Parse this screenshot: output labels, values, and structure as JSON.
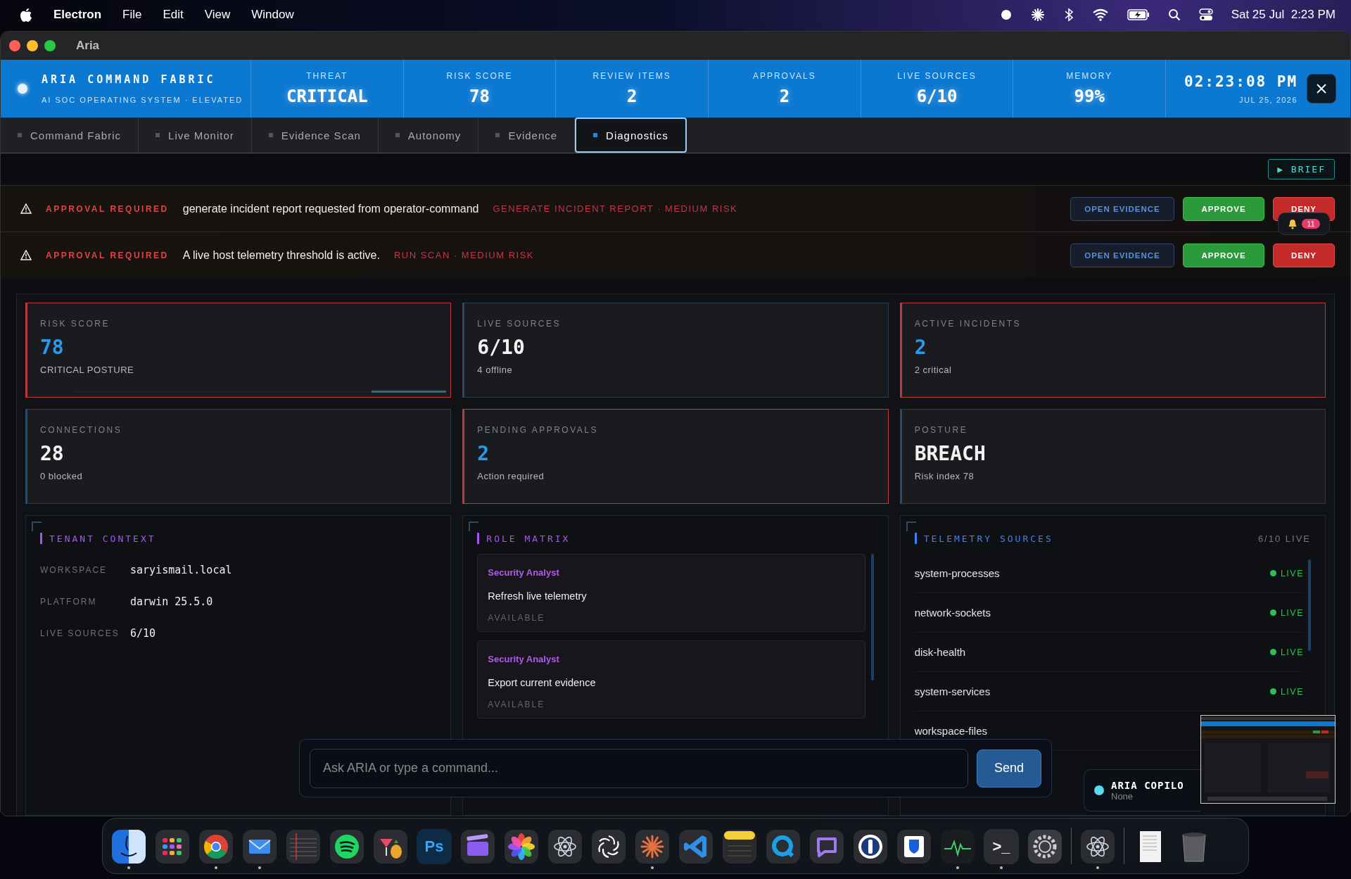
{
  "menu_bar": {
    "app": "Electron",
    "menus": [
      "File",
      "Edit",
      "View",
      "Window"
    ],
    "clock": "Sat 25 Jul  2:23 PM"
  },
  "window": {
    "title": "Aria"
  },
  "header": {
    "brand": "ARIA COMMAND FABRIC",
    "subtitle": "AI SOC OPERATING SYSTEM · ELEVATED",
    "metrics": [
      {
        "label": "THREAT",
        "value": "CRITICAL"
      },
      {
        "label": "RISK SCORE",
        "value": "78"
      },
      {
        "label": "REVIEW ITEMS",
        "value": "2"
      },
      {
        "label": "APPROVALS",
        "value": "2"
      },
      {
        "label": "LIVE SOURCES",
        "value": "6/10"
      },
      {
        "label": "MEMORY",
        "value": "99%"
      }
    ],
    "time": "02:23:08 PM",
    "date": "JUL 25, 2026"
  },
  "tabs": [
    {
      "label": "Command Fabric",
      "selected": false
    },
    {
      "label": "Live Monitor",
      "selected": false
    },
    {
      "label": "Evidence Scan",
      "selected": false
    },
    {
      "label": "Autonomy",
      "selected": false
    },
    {
      "label": "Evidence",
      "selected": false
    },
    {
      "label": "Diagnostics",
      "selected": true
    }
  ],
  "brief_button": "▶ BRIEF",
  "approvals": [
    {
      "label": "APPROVAL REQUIRED",
      "message": "generate incident report requested from operator-command",
      "tag": "GENERATE INCIDENT REPORT · MEDIUM RISK",
      "buttons": [
        "OPEN EVIDENCE",
        "APPROVE",
        "DENY"
      ]
    },
    {
      "label": "APPROVAL REQUIRED",
      "message": "A live host telemetry threshold is active.",
      "tag": "RUN SCAN · MEDIUM RISK",
      "buttons": [
        "OPEN EVIDENCE",
        "APPROVE",
        "DENY"
      ]
    }
  ],
  "notifications": {
    "count": "11"
  },
  "stat_cards": [
    {
      "label": "RISK SCORE",
      "value": "78",
      "sub": "CRITICAL POSTURE",
      "alert": true,
      "accent": true,
      "level": 0.2
    },
    {
      "label": "LIVE SOURCES",
      "value": "6/10",
      "sub": "4 offline",
      "alert": false,
      "accent": false
    },
    {
      "label": "ACTIVE INCIDENTS",
      "value": "2",
      "sub": "2 critical",
      "alert": true,
      "accent": true
    },
    {
      "label": "CONNECTIONS",
      "value": "28",
      "sub": "0 blocked",
      "alert": false,
      "accent": false
    },
    {
      "label": "PENDING APPROVALS",
      "value": "2",
      "sub": "Action required",
      "alert": true,
      "accent": true
    },
    {
      "label": "POSTURE",
      "value": "BREACH",
      "sub": "Risk index 78",
      "alert": false,
      "accent": false
    }
  ],
  "tenant_context": {
    "title": "TENANT CONTEXT",
    "color": "#a855f7",
    "rows": [
      {
        "key": "WORKSPACE",
        "value": "saryismail.local"
      },
      {
        "key": "PLATFORM",
        "value": "darwin 25.5.0"
      },
      {
        "key": "LIVE SOURCES",
        "value": "6/10"
      }
    ]
  },
  "role_matrix": {
    "title": "ROLE MATRIX",
    "color": "#a855f7",
    "items": [
      {
        "role": "Security Analyst",
        "action": "Refresh live telemetry",
        "status": "AVAILABLE"
      },
      {
        "role": "Security Analyst",
        "action": "Export current evidence",
        "status": "AVAILABLE"
      }
    ]
  },
  "telemetry_sources": {
    "title": "TELEMETRY SOURCES",
    "color": "#3b82f6",
    "summary": "6/10 LIVE",
    "items": [
      {
        "name": "system-processes",
        "status": "LIVE",
        "live": true
      },
      {
        "name": "network-sockets",
        "status": "LIVE",
        "live": true
      },
      {
        "name": "disk-health",
        "status": "LIVE",
        "live": true
      },
      {
        "name": "system-services",
        "status": "LIVE",
        "live": true
      },
      {
        "name": "workspace-files"
      }
    ]
  },
  "command_bar": {
    "placeholder": "Ask ARIA or type a command...",
    "button": "Send"
  },
  "copilot": {
    "title": "ARIA COPILO",
    "status": "None"
  },
  "dock": [
    {
      "kind": "face",
      "running": true
    },
    {
      "kind": "grid",
      "running": false
    },
    {
      "kind": "globe",
      "running": true
    },
    {
      "kind": "envelope",
      "running": true
    },
    {
      "kind": "ruled",
      "running": false
    },
    {
      "kind": "waves",
      "running": false
    },
    {
      "kind": "drink",
      "running": false
    },
    {
      "kind": "letters",
      "label": "Ps",
      "running": false
    },
    {
      "kind": "clapper",
      "running": false
    },
    {
      "kind": "flower",
      "running": false
    },
    {
      "kind": "atom",
      "running": false
    },
    {
      "kind": "knot",
      "running": false
    },
    {
      "kind": "asterisk",
      "running": true
    },
    {
      "kind": "code",
      "running": false
    },
    {
      "kind": "notepad",
      "running": false
    },
    {
      "kind": "magnifier",
      "running": false
    },
    {
      "kind": "bubble",
      "running": false
    },
    {
      "kind": "keyhole",
      "running": false
    },
    {
      "kind": "shield",
      "running": false
    },
    {
      "kind": "pulse",
      "running": true
    },
    {
      "kind": "letters",
      "label": ">_",
      "running": true
    },
    {
      "kind": "gear",
      "running": false
    },
    {
      "kind": "divider"
    },
    {
      "kind": "atom",
      "running": true
    },
    {
      "kind": "divider"
    },
    {
      "kind": "document",
      "running": false
    },
    {
      "kind": "trash",
      "running": false
    }
  ]
}
